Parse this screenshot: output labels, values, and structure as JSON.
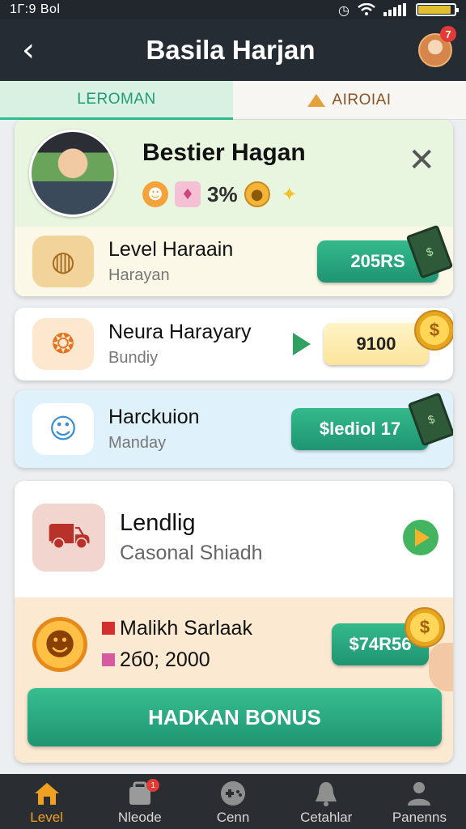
{
  "status_bar": {
    "time": "1Г:9 Bol"
  },
  "app_bar": {
    "title": "Basila Harjan",
    "notification_count": "7"
  },
  "tabs": [
    {
      "label": "LEROMAN",
      "active": true
    },
    {
      "label": "AIROIAI",
      "active": false
    }
  ],
  "profile": {
    "name": "Bestier Hagan",
    "stat_value": "3%"
  },
  "rows": [
    {
      "title": "Level Haraain",
      "subtitle": "Harayan",
      "button": "205RS",
      "icon": "basket-icon"
    },
    {
      "title": "Neura Harayary",
      "subtitle": "Bundiy",
      "button": "9100",
      "icon": "mango-icon"
    },
    {
      "title": "Harckuion",
      "subtitle": "Manday",
      "button": "$lediol 17",
      "icon": "robot-icon"
    }
  ],
  "delivery": {
    "title": "Lendlig",
    "subtitle": "Casonal Shiadh",
    "icon": "truck-icon"
  },
  "bonus": {
    "line1": "Malikh Sarlaak",
    "line2": "2б0; 2000",
    "amount": "$74R56",
    "cta": "HADKAN BONUS",
    "icon": "smiley-coin-icon"
  },
  "bottom_nav": [
    {
      "label": "Level",
      "icon": "home-icon",
      "active": true
    },
    {
      "label": "Nleode",
      "icon": "bag-icon",
      "active": false,
      "badge": "1"
    },
    {
      "label": "Cenn",
      "icon": "gamepad-icon",
      "active": false
    },
    {
      "label": "Cetahlar",
      "icon": "bell-icon",
      "active": false
    },
    {
      "label": "Panenns",
      "icon": "person-icon",
      "active": false
    }
  ],
  "colors": {
    "accent": "#2ebf8f",
    "button_green": "#1f9571",
    "header": "#262c33",
    "coin": "#f2b53a"
  }
}
